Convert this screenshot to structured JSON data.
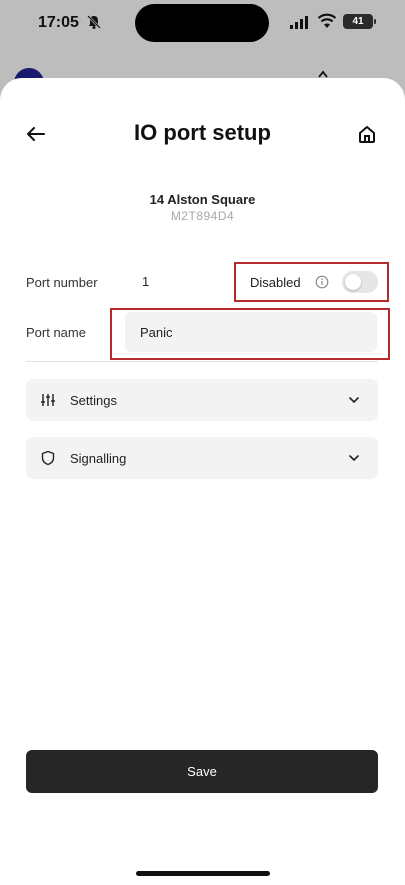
{
  "status_bar": {
    "time": "17:05",
    "battery": "41",
    "icons": [
      "bell-off-icon",
      "signal-icon",
      "wifi-icon",
      "battery-icon"
    ]
  },
  "header": {
    "title": "IO port setup",
    "back_icon": "arrow-left-icon",
    "home_icon": "home-icon"
  },
  "site": {
    "name": "14 Alston Square",
    "code": "M2T894D4"
  },
  "port": {
    "number_label": "Port number",
    "number_value": "1",
    "disabled_label": "Disabled",
    "disabled_on": false,
    "name_label": "Port name",
    "name_value": "Panic"
  },
  "sections": [
    {
      "label": "Settings",
      "icon": "sliders-icon"
    },
    {
      "label": "Signalling",
      "icon": "shield-icon"
    }
  ],
  "actions": {
    "save_label": "Save"
  },
  "colors": {
    "highlight": "#b52a2a",
    "save_button": "#262626",
    "field_bg": "#f3f3f3"
  }
}
